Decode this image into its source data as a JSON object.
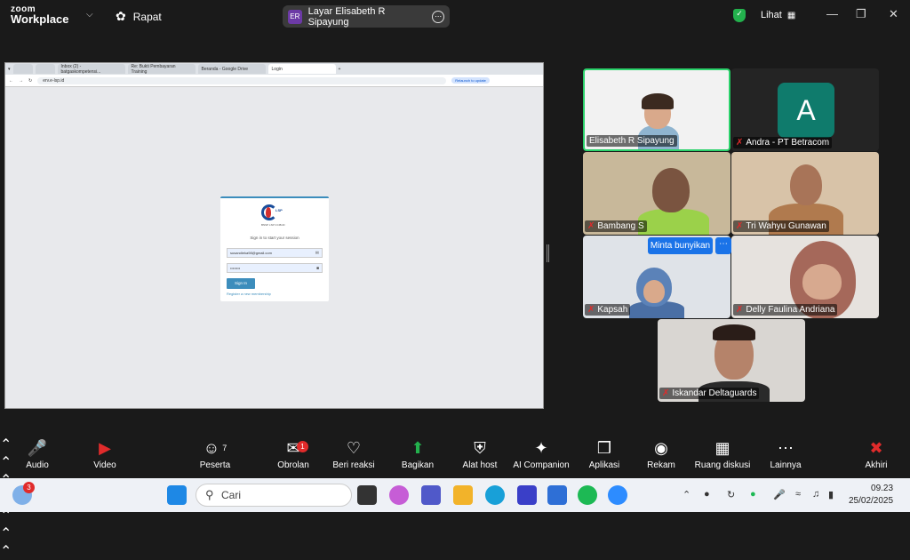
{
  "app": {
    "logo_line1": "zoom",
    "logo_line2": "Workplace",
    "meeting_label": "Rapat",
    "share_initials": "ER",
    "share_label": "Layar Elisabeth R Sipayung",
    "view_label": "Lihat"
  },
  "browser": {
    "tabs": [
      "Inbox (2) - batgaskompetensi...",
      "Re: Bukti Pembayaran Training",
      "Beranda - Google Drive",
      "Login"
    ],
    "url": "erv.e-lsp.id",
    "relaunch": "Relaunch to update"
  },
  "login": {
    "brand": "LSP",
    "brand_sub": "BNSP LSP CCIB-ID",
    "message": "Sign in to start your session",
    "email_value": "susandieka98@gmail.com",
    "password_value": "••••••••",
    "signin_label": "Sign In",
    "register_link": "Register a new membership"
  },
  "participants": [
    {
      "name": "Elisabeth R Sipayung",
      "muted": false
    },
    {
      "name": "Andra - PT Betracom",
      "muted": true,
      "initial": "A"
    },
    {
      "name": "Bambang S",
      "muted": true
    },
    {
      "name": "Tri Wahyu Gunawan",
      "muted": true
    },
    {
      "name": "Kapsah",
      "muted": true
    },
    {
      "name": "Delly Faulina Andriana",
      "muted": true
    },
    {
      "name": "Iskandar Deltaguards",
      "muted": true
    }
  ],
  "ask_unmute": "Minta bunyikan",
  "toolbar": {
    "audio": "Audio",
    "video": "Video",
    "participants": "Peserta",
    "participants_count": "7",
    "chat": "Obrolan",
    "chat_badge": "1",
    "react": "Beri reaksi",
    "share": "Bagikan",
    "host_tools": "Alat host",
    "ai": "AI Companion",
    "apps": "Aplikasi",
    "record": "Rekam",
    "rooms": "Ruang diskusi",
    "more": "Lainnya",
    "end": "Akhiri"
  },
  "taskbar": {
    "weather_badge": "3",
    "search_placeholder": "Cari",
    "time": "09.23",
    "date": "25/02/2025"
  },
  "colors": {
    "active_speaker": "#2bd26b",
    "accent": "#1a73e8",
    "mute": "#e02b2b"
  }
}
